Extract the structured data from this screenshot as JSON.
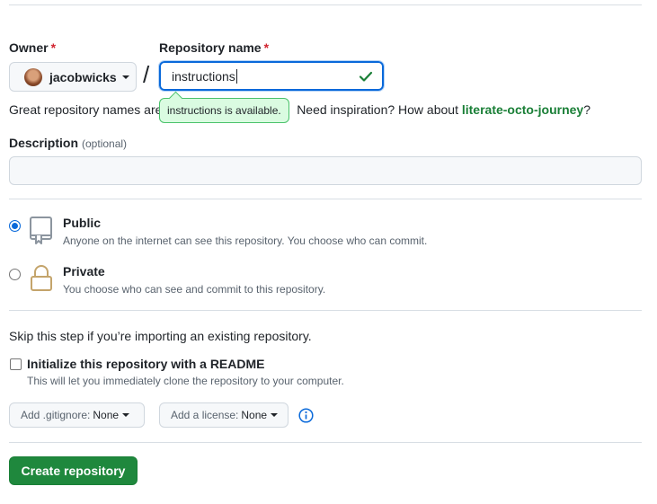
{
  "owner": {
    "label": "Owner",
    "required_mark": "*",
    "value": "jacobwicks"
  },
  "repo_name": {
    "label": "Repository name",
    "required_mark": "*",
    "value": "instructions",
    "availability_tooltip": "instructions is available."
  },
  "separator": "/",
  "hint": {
    "prefix": "Great repository names are",
    "middle": "Need inspiration? How about",
    "suggestion": "literate-octo-journey",
    "suffix": "?"
  },
  "description": {
    "label": "Description",
    "optional": "(optional)",
    "value": ""
  },
  "visibility": {
    "public": {
      "title": "Public",
      "desc": "Anyone on the internet can see this repository. You choose who can commit.",
      "selected": true
    },
    "private": {
      "title": "Private",
      "desc": "You choose who can see and commit to this repository.",
      "selected": false
    }
  },
  "import_note": "Skip this step if you’re importing an existing repository.",
  "readme": {
    "label": "Initialize this repository with a README",
    "desc": "This will let you immediately clone the repository to your computer.",
    "checked": false
  },
  "gitignore": {
    "label": "Add .gitignore:",
    "value": "None"
  },
  "license": {
    "label": "Add a license:",
    "value": "None"
  },
  "create_label": "Create repository",
  "colors": {
    "primary_button": "#1f883d",
    "focus_blue": "#0969da",
    "success_green": "#1a7f37"
  }
}
